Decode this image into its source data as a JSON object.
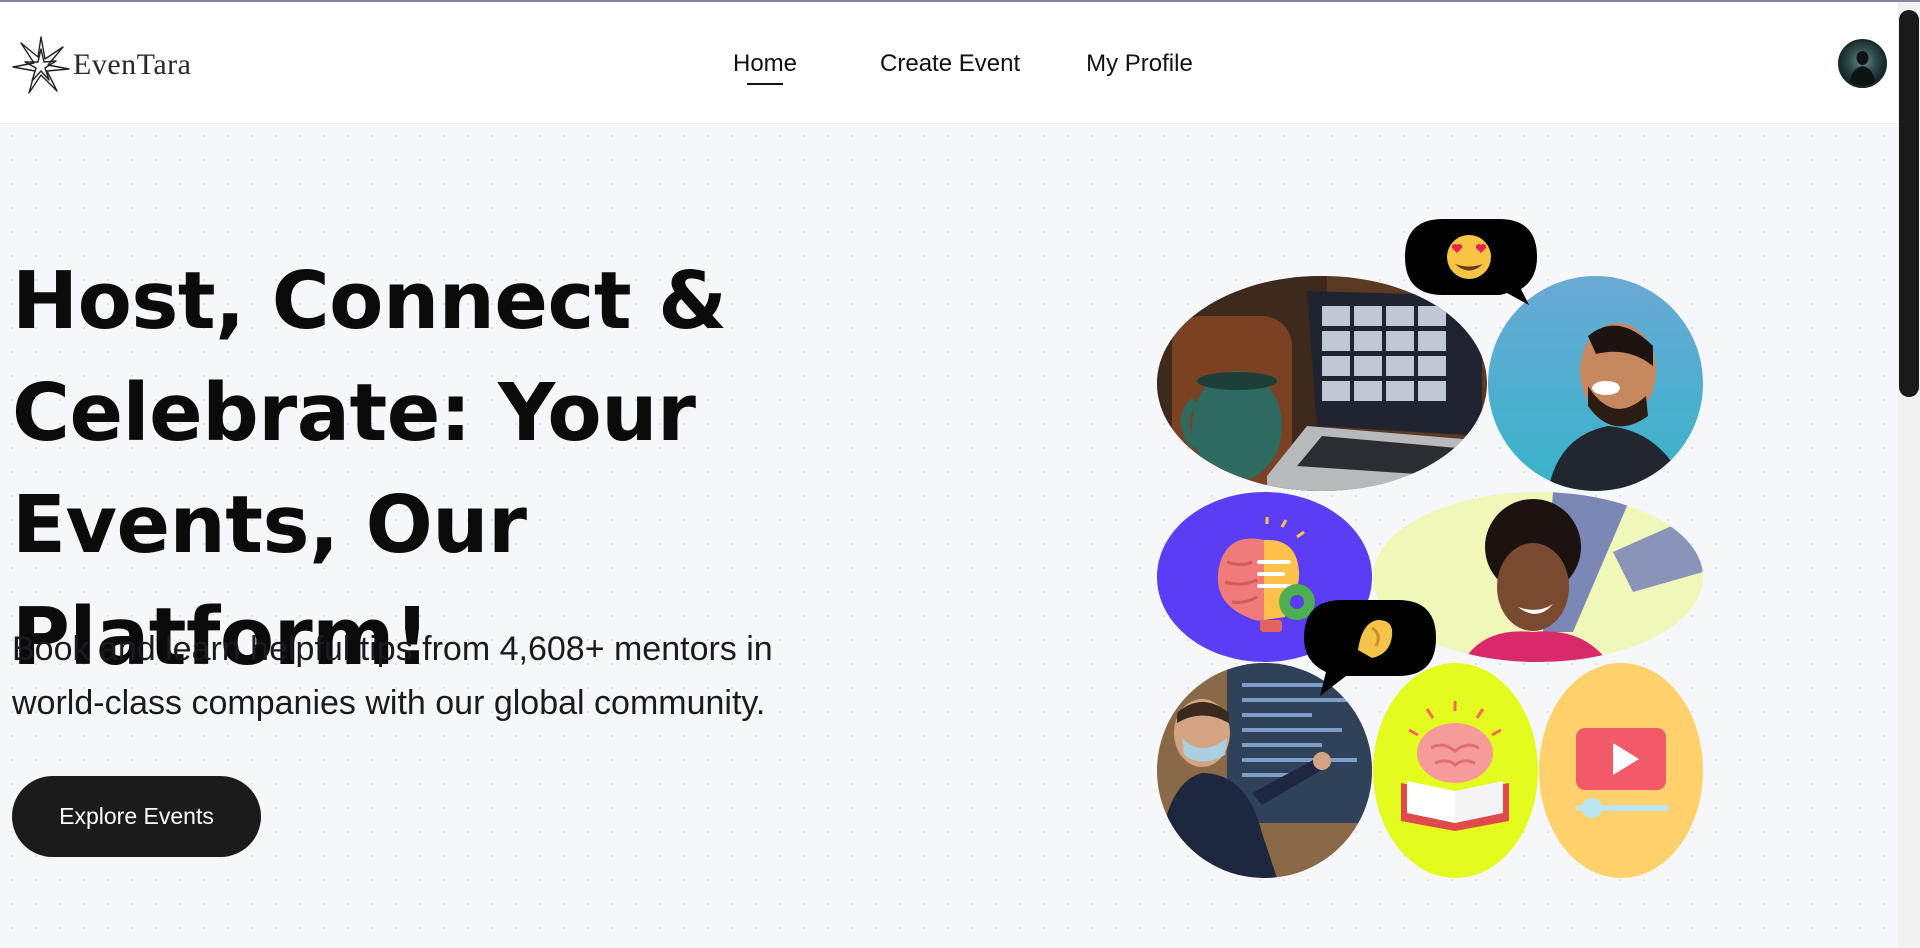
{
  "brand": {
    "name": "EvenTara",
    "logo_icon": "star-flower-icon"
  },
  "nav": {
    "links": [
      {
        "label": "Home",
        "active": true
      },
      {
        "label": "Create Event",
        "active": false
      },
      {
        "label": "My Profile",
        "active": false
      }
    ],
    "avatar_icon": "user-avatar"
  },
  "hero": {
    "headline": "Host, Connect & Celebrate: Your Events, Our Platform!",
    "subtext": "Book and learn helpful tips from 4,608+ mentors in world-class companies with our global community.",
    "cta_label": "Explore Events"
  },
  "collage": {
    "tiles": [
      "laptop-video-call-photo",
      "smiling-man-photo",
      "brain-lightbulb-icon",
      "smiling-woman-photo",
      "presenter-with-mask-photo",
      "brain-book-icon",
      "video-play-icon"
    ],
    "bubbles": [
      "heart-eyes-emoji",
      "pinched-fingers-emoji"
    ]
  },
  "colors": {
    "hero_bg": "#f6f7fb",
    "button_bg": "#1b1b1c",
    "purple_tile": "#5b3df5",
    "lime_tile": "#e3fb1f",
    "yellow_tile": "#ffd16a"
  }
}
